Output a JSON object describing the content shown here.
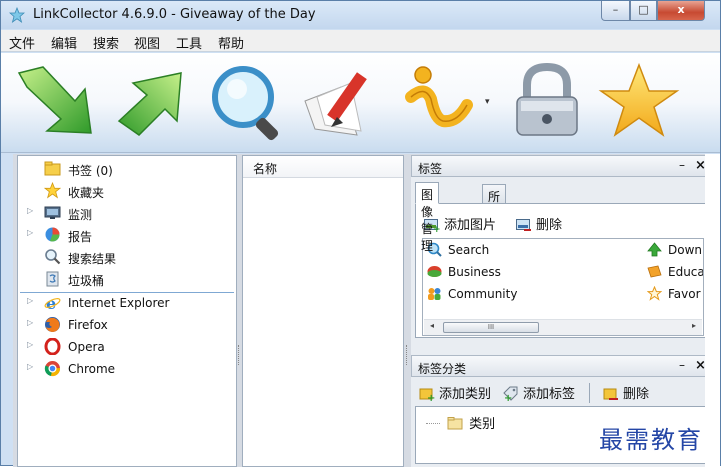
{
  "window": {
    "title": "LinkCollector 4.6.9.0 - Giveaway of the Day",
    "controls": {
      "minimize": "–",
      "maximize": "□",
      "close": "x"
    }
  },
  "menu": [
    "文件",
    "编辑",
    "搜索",
    "视图",
    "工具",
    "帮助"
  ],
  "toolbar": {
    "icons": [
      "arrow-down-icon",
      "arrow-up-icon",
      "magnifier-icon",
      "edit-pencil-icon",
      "info-icon",
      "padlock-icon",
      "star-icon"
    ],
    "dropdown_glyph": "▾"
  },
  "tree": {
    "items": [
      {
        "label": "书签 (0)",
        "icon": "folder-icon",
        "expander": ""
      },
      {
        "label": "收藏夹",
        "icon": "favorites-star-icon",
        "expander": ""
      },
      {
        "label": "监测",
        "icon": "monitor-icon",
        "expander": "▷"
      },
      {
        "label": "报告",
        "icon": "pie-chart-icon",
        "expander": "▷"
      },
      {
        "label": "搜索结果",
        "icon": "search-icon",
        "expander": ""
      },
      {
        "label": "垃圾桶",
        "icon": "trash-icon",
        "expander": ""
      }
    ],
    "browsers": [
      {
        "label": "Internet Explorer",
        "icon": "ie-icon",
        "expander": "▷"
      },
      {
        "label": "Firefox",
        "icon": "firefox-icon",
        "expander": "▷"
      },
      {
        "label": "Opera",
        "icon": "opera-icon",
        "expander": "▷"
      },
      {
        "label": "Chrome",
        "icon": "chrome-icon",
        "expander": "▷"
      }
    ]
  },
  "middle": {
    "column_header": "名称"
  },
  "tags_pane": {
    "title": "标签",
    "pin": "–",
    "close": "×",
    "tabs": [
      "图像管理",
      "所有标签"
    ],
    "actions": {
      "add_image": "添加图片",
      "delete": "删除"
    },
    "tags_left": [
      "Search",
      "Business",
      "Community"
    ],
    "tags_right": [
      "Down",
      "Educa",
      "Favor"
    ],
    "scroll": {
      "left": "◂",
      "right": "▸",
      "thumb": "III"
    }
  },
  "categories_pane": {
    "title": "标签分类",
    "pin": "–",
    "close": "×",
    "actions": {
      "add_category": "添加类别",
      "add_tag": "添加标签",
      "delete": "删除"
    },
    "root": "类别"
  },
  "watermark": "最需教育"
}
